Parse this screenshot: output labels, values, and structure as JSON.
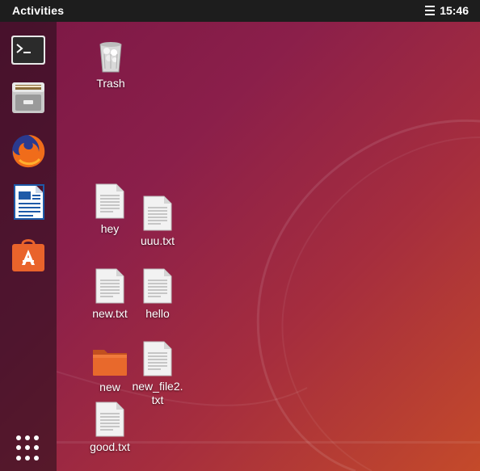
{
  "topbar": {
    "activities_label": "Activities",
    "clock": "15:46"
  },
  "dock": {
    "items": [
      {
        "name": "terminal",
        "icon": "terminal-icon"
      },
      {
        "name": "files",
        "icon": "file-cabinet-icon"
      },
      {
        "name": "firefox",
        "icon": "firefox-icon"
      },
      {
        "name": "writer",
        "icon": "libreoffice-writer-icon"
      },
      {
        "name": "software",
        "icon": "shopping-bag-icon"
      }
    ],
    "show_apps": "apps-grid-icon"
  },
  "desktop": {
    "icons": [
      {
        "label": "Trash",
        "type": "trash"
      },
      {
        "label": "hey",
        "type": "text-file"
      },
      {
        "label": "uuu.txt",
        "type": "text-file"
      },
      {
        "label": "new.txt",
        "type": "text-file"
      },
      {
        "label": "hello",
        "type": "text-file"
      },
      {
        "label": "new",
        "type": "folder"
      },
      {
        "label": "new_file2.\ntxt",
        "type": "text-file"
      },
      {
        "label": "good.txt",
        "type": "text-file"
      }
    ]
  },
  "colors": {
    "topbar": "#1d1d1d",
    "wallpaper_start": "#7a1745",
    "wallpaper_end": "#c44a2a",
    "folder": "#e0662c"
  }
}
